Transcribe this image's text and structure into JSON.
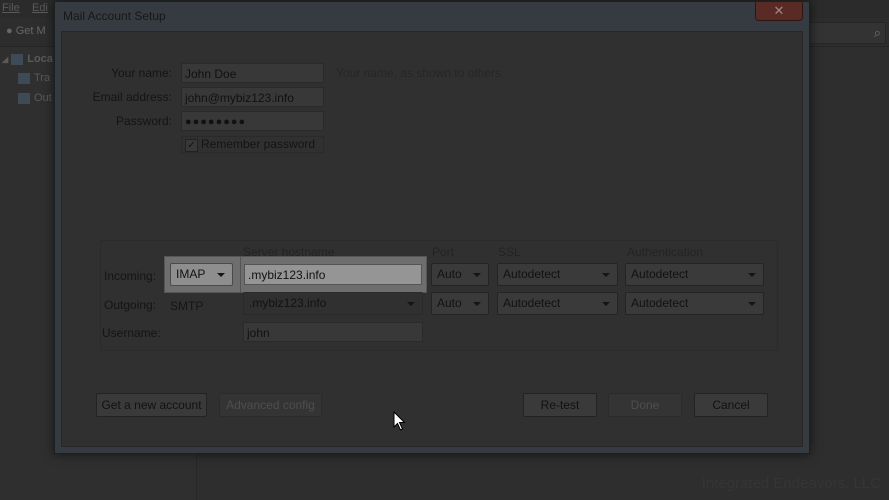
{
  "background_app": {
    "menu": [
      "File",
      "Edi"
    ],
    "toolbar_get_label": "Get M",
    "tree": [
      "Loca",
      "Tra",
      "Out"
    ],
    "watermark": "Integrated Endeavors, LLC"
  },
  "dialog": {
    "title": "Mail Account Setup",
    "close_glyph": "✕",
    "name_label": "Your name:",
    "name_value": "John Doe",
    "name_hint": "Your name, as shown to others",
    "email_label": "Email address:",
    "email_value": "john@mybiz123.info",
    "password_label": "Password:",
    "password_value": "●●●●●●●●",
    "remember_label": "Remember password",
    "remember_checked": "✓",
    "columns": {
      "hostname": "Server hostname",
      "port": "Port",
      "ssl": "SSL",
      "auth": "Authentication"
    },
    "incoming": {
      "label": "Incoming:",
      "protocol": "IMAP",
      "hostname": ".mybiz123.info",
      "port": "Auto",
      "ssl": "Autodetect",
      "auth": "Autodetect"
    },
    "outgoing": {
      "label": "Outgoing:",
      "protocol": "SMTP",
      "hostname": ".mybiz123.info",
      "port": "Auto",
      "ssl": "Autodetect",
      "auth": "Autodetect"
    },
    "username_label": "Username:",
    "username_value": "john",
    "buttons": {
      "new_account": "Get a new account",
      "advanced": "Advanced config",
      "retest": "Re-test",
      "done": "Done",
      "cancel": "Cancel"
    }
  }
}
